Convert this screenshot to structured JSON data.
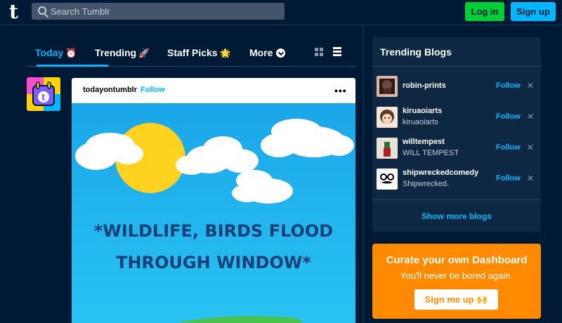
{
  "header": {
    "logo": "t",
    "search_placeholder": "Search Tumblr",
    "login_label": "Log in",
    "signup_label": "Sign up"
  },
  "tabs": [
    {
      "label": "Today",
      "emoji": "⏰",
      "active": true
    },
    {
      "label": "Trending",
      "emoji": "🚀",
      "active": false
    },
    {
      "label": "Staff Picks",
      "emoji": "🌟",
      "active": false
    },
    {
      "label": "More",
      "emoji": "",
      "active": false
    }
  ],
  "post": {
    "blog_name": "todayontumblr",
    "follow_label": "Follow",
    "menu": "•••",
    "image_text_line1": "*WILDLIFE, BIRDS FLOOD",
    "image_text_line2": "THROUGH WINDOW*"
  },
  "sidebar": {
    "title": "Trending Blogs",
    "blogs": [
      {
        "name": "robin-prints",
        "subtitle": "",
        "follow": "Follow",
        "close": "✕"
      },
      {
        "name": "kiruaoiarts",
        "subtitle": "kiruaoiarts",
        "follow": "Follow",
        "close": "✕"
      },
      {
        "name": "willtempest",
        "subtitle": "WILL TEMPEST",
        "follow": "Follow",
        "close": "✕"
      },
      {
        "name": "shipwreckedcomedy",
        "subtitle": "Shipwrecked.",
        "follow": "Follow",
        "close": "✕"
      }
    ],
    "show_more": "Show more blogs"
  },
  "curate": {
    "title": "Curate your own Dashboard",
    "subtitle": "You'll never be bored again.",
    "button_label": "Sign me up 🙌"
  },
  "colors": {
    "background": "#001935",
    "accent_blue": "#00b8ff",
    "login_green": "#00cf35",
    "curate_orange": "#ff8a00",
    "panel": "#0e2742"
  }
}
